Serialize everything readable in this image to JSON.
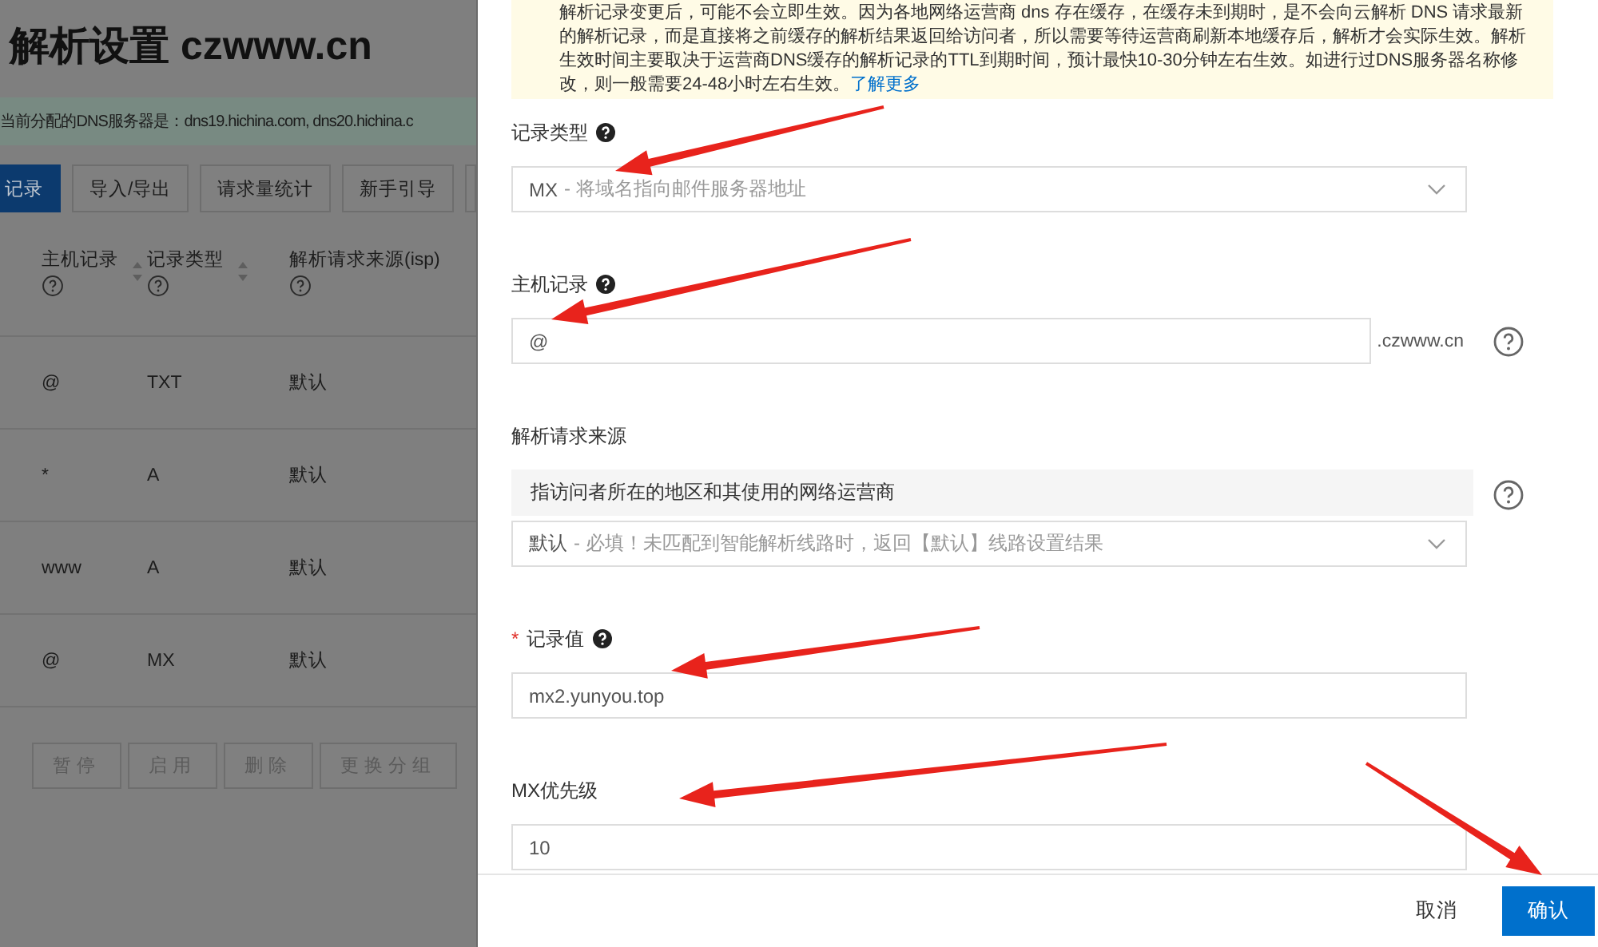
{
  "background_page": {
    "title": "解析设置 czwww.cn",
    "dns_notice": "当前分配的DNS服务器是：dns19.hichina.com, dns20.hichina.c",
    "tabs": [
      {
        "label": "记录",
        "selected": true
      },
      {
        "label": "导入/导出",
        "selected": false
      },
      {
        "label": "请求量统计",
        "selected": false
      },
      {
        "label": "新手引导",
        "selected": false
      }
    ],
    "table": {
      "columns": [
        "主机记录",
        "记录类型",
        "解析请求来源(isp)"
      ],
      "rows": [
        [
          "@",
          "TXT",
          "默认"
        ],
        [
          "*",
          "A",
          "默认"
        ],
        [
          "www",
          "A",
          "默认"
        ],
        [
          "@",
          "MX",
          "默认"
        ]
      ]
    },
    "batch_buttons": [
      {
        "label": "暂停",
        "disabled": true
      },
      {
        "label": "启用",
        "disabled": true
      },
      {
        "label": "删除",
        "disabled": true
      },
      {
        "label": "更换分组",
        "disabled": true
      }
    ]
  },
  "drawer": {
    "notice": {
      "text": "解析记录变更后，可能不会立即生效。因为各地网络运营商 dns 存在缓存，在缓存未到期时，是不会向云解析 DNS 请求最新的解析记录，而是直接将之前缓存的解析结果返回给访问者，所以需要等待运营商刷新本地缓存后，解析才会实际生效。解析生效时间主要取决于运营商DNS缓存的解析记录的TTL到期时间，预计最快10-30分钟左右生效。如进行过DNS服务器名称修改，则一般需要24-48小时左右生效。",
      "link": "了解更多"
    },
    "fields": [
      {
        "kind": "select",
        "label": "记录类型",
        "required": false,
        "help_icon": true,
        "value": "MX",
        "hint": "- 将域名指向邮件服务器地址"
      },
      {
        "kind": "suffix_input",
        "label": "主机记录",
        "required": false,
        "help_icon": true,
        "value": "@",
        "suffix": ".czwww.cn"
      },
      {
        "kind": "isp_select",
        "label": "解析请求来源",
        "required": false,
        "help_icon": false,
        "description": "指访问者所在的地区和其使用的网络运营商",
        "value": "默认",
        "hint": "- 必填！未匹配到智能解析线路时，返回【默认】线路设置结果"
      },
      {
        "kind": "input",
        "label": "记录值",
        "required": true,
        "help_icon": true,
        "value": "mx2.yunyou.top"
      },
      {
        "kind": "input",
        "label": "MX优先级",
        "required": false,
        "help_icon": false,
        "value": "10"
      }
    ],
    "footer_buttons": [
      {
        "label": "取消",
        "primary": false
      },
      {
        "label": "确认",
        "primary": true
      }
    ]
  }
}
